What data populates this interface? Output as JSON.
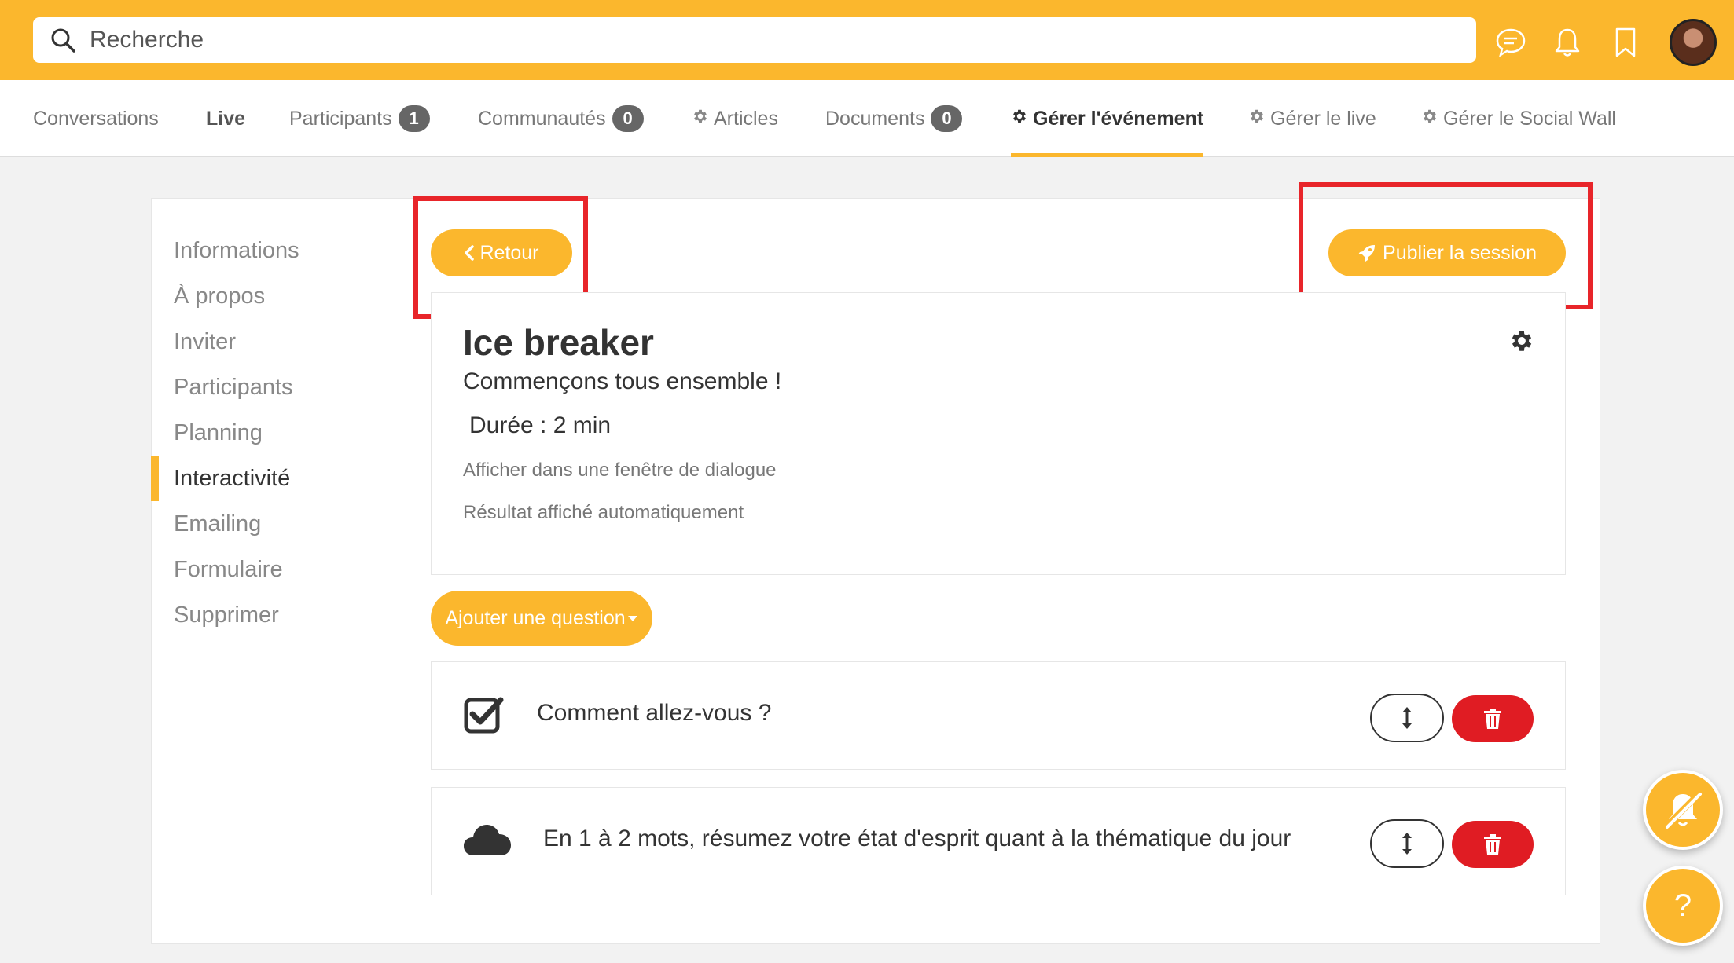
{
  "search": {
    "placeholder": "Recherche"
  },
  "topbar": {
    "icons": [
      "chat-icon",
      "bell-icon",
      "bookmark-icon",
      "avatar"
    ]
  },
  "tabs": [
    {
      "label": "Conversations"
    },
    {
      "label": "Live"
    },
    {
      "label": "Participants",
      "badge": "1"
    },
    {
      "label": "Communautés",
      "badge": "0"
    },
    {
      "label": "Articles",
      "icon": "gear-icon"
    },
    {
      "label": "Documents",
      "badge": "0"
    },
    {
      "label": "Gérer l'événement",
      "icon": "gear-icon",
      "active": true
    },
    {
      "label": "Gérer le live",
      "icon": "gear-icon"
    },
    {
      "label": "Gérer le Social Wall",
      "icon": "gear-icon"
    }
  ],
  "sidebar": {
    "items": [
      {
        "label": "Informations"
      },
      {
        "label": "À propos"
      },
      {
        "label": "Inviter"
      },
      {
        "label": "Participants"
      },
      {
        "label": "Planning"
      },
      {
        "label": "Interactivité",
        "active": true
      },
      {
        "label": "Emailing"
      },
      {
        "label": "Formulaire"
      },
      {
        "label": "Supprimer"
      }
    ]
  },
  "actions": {
    "back_label": "Retour",
    "publish_label": "Publier la session",
    "add_question_label": "Ajouter une question"
  },
  "session": {
    "title": "Ice breaker",
    "subtitle": "Commençons tous ensemble !",
    "duration": "Durée : 2 min",
    "option_dialog": "Afficher dans une fenêtre de dialogue",
    "option_result": "Résultat affiché automatiquement"
  },
  "questions": [
    {
      "text": "Comment allez-vous ?",
      "icon": "checkbox-icon"
    },
    {
      "text": "En 1 à 2 mots, résumez votre état d'esprit quant à la thématique du jour",
      "icon": "cloud-icon"
    }
  ],
  "floating": {
    "help_label": "?"
  },
  "colors": {
    "accent": "#fbb72d",
    "danger": "#e01c23",
    "highlight": "#e8252a"
  }
}
